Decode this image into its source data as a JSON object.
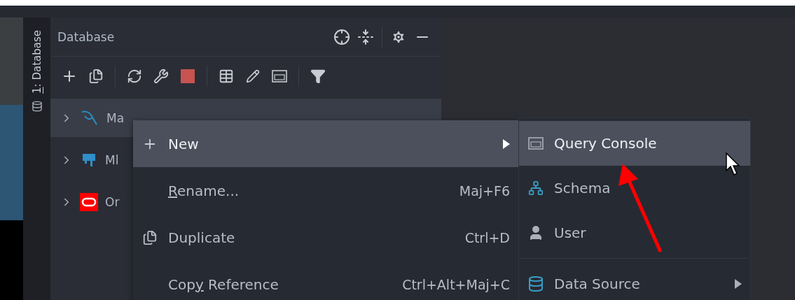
{
  "side_tab": {
    "label": "1: Database"
  },
  "panel": {
    "title": "Database"
  },
  "tree": [
    {
      "label": "Ma",
      "selected": true
    },
    {
      "label": "Ml",
      "selected": false
    },
    {
      "label": "Or",
      "selected": false
    }
  ],
  "context_menu": [
    {
      "label": "New",
      "submenu": true,
      "selected": true
    },
    {
      "label": "Rename...",
      "shortcut": "Maj+F6",
      "submenu": false,
      "selected": false
    },
    {
      "label": "Duplicate",
      "shortcut": "Ctrl+D",
      "submenu": false,
      "selected": false
    },
    {
      "label": "Copy Reference",
      "shortcut": "Ctrl+Alt+Maj+C",
      "submenu": false,
      "selected": false
    }
  ],
  "submenu": [
    {
      "kind": "item",
      "label": "Query Console",
      "submenu": false,
      "selected": true
    },
    {
      "kind": "item",
      "label": "Schema",
      "submenu": false,
      "selected": false
    },
    {
      "kind": "item",
      "label": "User",
      "submenu": false,
      "selected": false
    },
    {
      "kind": "separator"
    },
    {
      "kind": "item",
      "label": "Data Source",
      "submenu": true,
      "selected": false
    }
  ]
}
